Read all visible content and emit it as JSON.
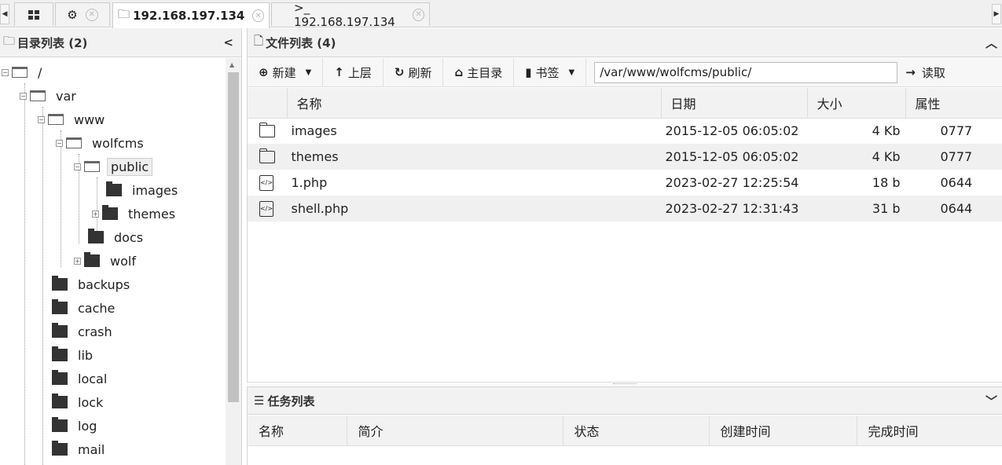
{
  "tabs": [
    {
      "label": "",
      "icon": "grid-icon"
    },
    {
      "label": "",
      "icon": "gear-icon"
    },
    {
      "label": "192.168.197.134",
      "icon": "folder-icon",
      "active": true
    },
    {
      "label": ">_ 192.168.197.134",
      "icon": "terminal-icon"
    }
  ],
  "left_panel": {
    "title": "目录列表 (2)",
    "tree": [
      {
        "label": "/",
        "open": true
      },
      {
        "label": "var",
        "open": true
      },
      {
        "label": "www",
        "open": true
      },
      {
        "label": "wolfcms",
        "open": true
      },
      {
        "label": "public",
        "open": true,
        "selected": true
      },
      {
        "label": "images"
      },
      {
        "label": "themes",
        "expandable": true
      },
      {
        "label": "docs"
      },
      {
        "label": "wolf",
        "expandable": true
      },
      {
        "label": "backups"
      },
      {
        "label": "cache"
      },
      {
        "label": "crash"
      },
      {
        "label": "lib"
      },
      {
        "label": "local"
      },
      {
        "label": "lock"
      },
      {
        "label": "log"
      },
      {
        "label": "mail"
      }
    ]
  },
  "file_panel": {
    "title": "文件列表 (4)",
    "toolbar": {
      "new": "新建",
      "up": "上层",
      "refresh": "刷新",
      "home": "主目录",
      "bookmark": "书签",
      "path": "/var/www/wolfcms/public/",
      "read": "读取"
    },
    "columns": [
      "名称",
      "日期",
      "大小",
      "属性"
    ],
    "rows": [
      {
        "type": "dir",
        "name": "images",
        "date": "2015-12-05 06:05:02",
        "size": "4 Kb",
        "perm": "0777"
      },
      {
        "type": "dir",
        "name": "themes",
        "date": "2015-12-05 06:05:02",
        "size": "4 Kb",
        "perm": "0777"
      },
      {
        "type": "file",
        "name": "1.php",
        "date": "2023-02-27 12:25:54",
        "size": "18 b",
        "perm": "0644"
      },
      {
        "type": "file",
        "name": "shell.php",
        "date": "2023-02-27 12:31:43",
        "size": "31 b",
        "perm": "0644"
      }
    ]
  },
  "task_panel": {
    "title": "任务列表",
    "columns": [
      "名称",
      "简介",
      "状态",
      "创建时间",
      "完成时间"
    ]
  }
}
